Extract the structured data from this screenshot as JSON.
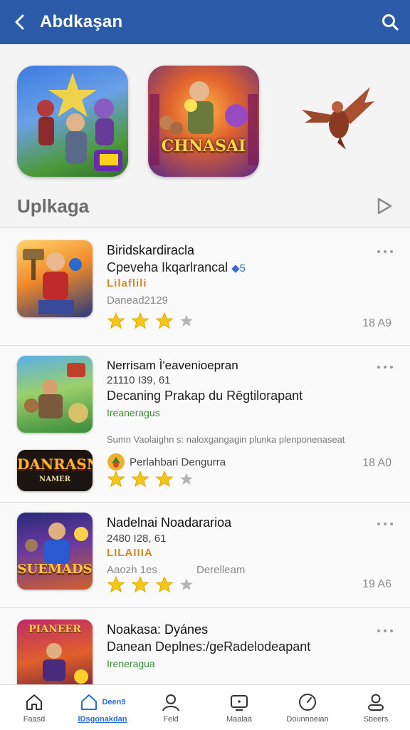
{
  "header": {
    "title": "Abdkaşan",
    "back_icon": "back-arrow-icon",
    "search_icon": "search-icon"
  },
  "featured": [
    {
      "label": ""
    },
    {
      "label": "CHNASAI"
    }
  ],
  "section": {
    "title": "Uplkaga",
    "action_icon": "play-icon"
  },
  "items": [
    {
      "name": "Biridskardiracla",
      "subtitle": "Cpeveha Ikqarlrancal",
      "badge": "5",
      "orange": "Lilaflili",
      "meta": "Danead2129",
      "stars": 3,
      "rating_text": "18 A9"
    },
    {
      "name": "Nerrisam Ì'eavenioepran",
      "stats": "21110 I39, 61",
      "subtitle": "Decaning Prakap du Rēgtilorapant",
      "green": "Ireaneragus",
      "description": "Sumn Vaolaighn s: naloxgangagin plunka plenponenaseat",
      "dev": "Perlahbari Dengurra",
      "thumb2_label": "DANRASN",
      "thumb2_sub": "NAMER",
      "stars": 3,
      "rating_text": "18 A0"
    },
    {
      "name": "Nadelnai Noadararioa",
      "stats": "2480 I28, 61",
      "orange": "LILAIIIA",
      "meta": "Aaozh 1es",
      "meta2": "Derelleam",
      "thumb_label": "SUEMADS",
      "stars": 3,
      "rating_text": "19 A6"
    },
    {
      "name": "Noakasa: Dyánes",
      "subtitle": "Danean Deplnes:/geRadelodeapant",
      "green": "Ireneragua",
      "thumb_label": "PIANEER"
    }
  ],
  "bottom_nav": [
    {
      "label": "Faasd",
      "icon": "home-icon"
    },
    {
      "label": "IDsgonakdan",
      "icon": "home-outline-icon",
      "badge": "Deen9",
      "active": true
    },
    {
      "label": "Feld",
      "icon": "user-icon"
    },
    {
      "label": "Maalaa",
      "icon": "tv-icon"
    },
    {
      "label": "Dounnoeian",
      "icon": "compass-icon"
    },
    {
      "label": "Sbeers",
      "icon": "profile-icon"
    }
  ],
  "colors": {
    "header_bg": "#2a5aa8",
    "star": "#f5c518",
    "star_empty": "#b5b5b5",
    "active_nav": "#2a6fd1"
  }
}
